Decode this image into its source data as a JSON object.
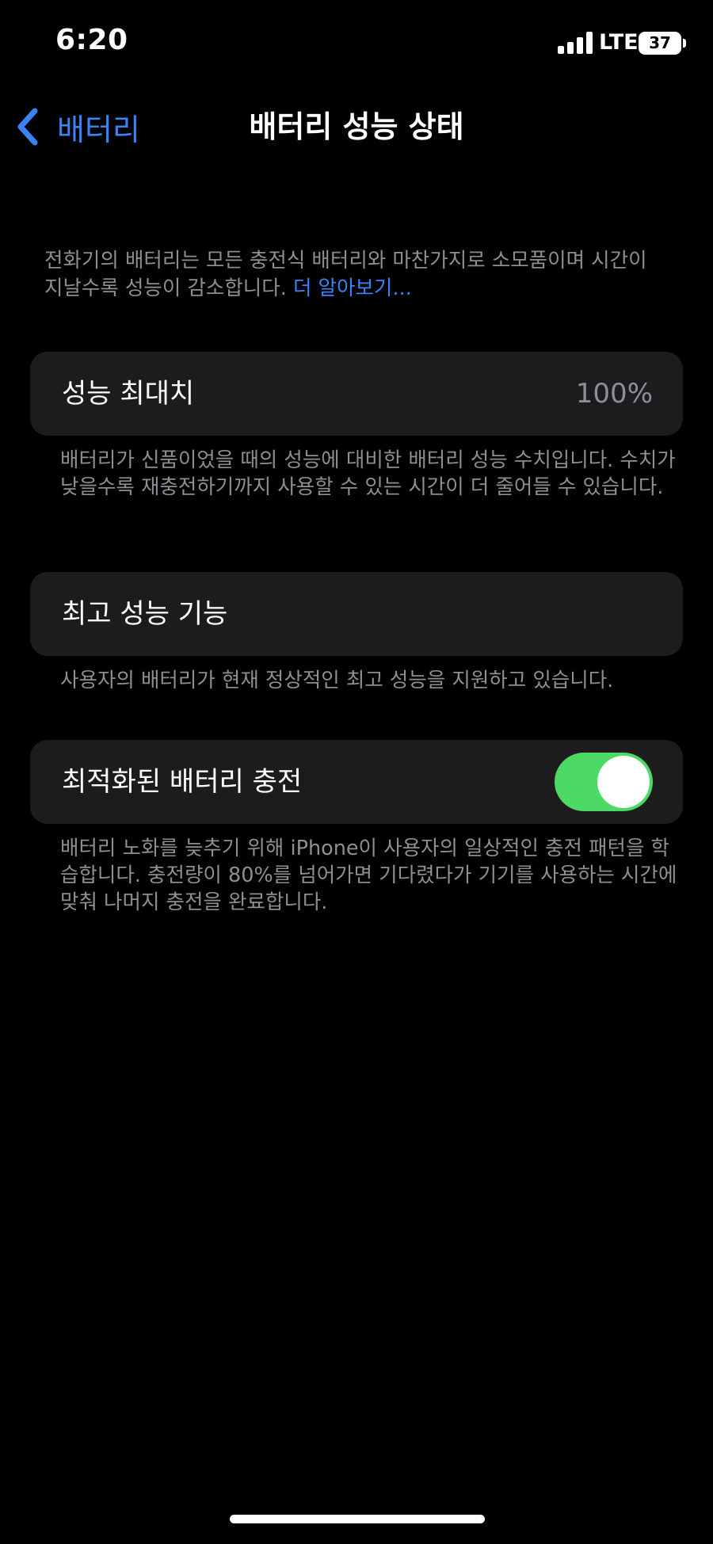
{
  "status_bar": {
    "time": "6:20",
    "network": "LTE",
    "battery_level": "37",
    "icons": [
      "signal-icon",
      "battery-icon"
    ]
  },
  "nav": {
    "back_label": "배터리",
    "title": "배터리 성능 상태",
    "back_icon": "chevron-left-icon"
  },
  "intro": {
    "text": "전화기의 배터리는 모든 충전식 배터리와 마찬가지로 소모품이며 시간이 지날수록 성능이 감소합니다. ",
    "link": "더 알아보기..."
  },
  "max_capacity": {
    "label": "성능 최대치",
    "value": "100%",
    "footer": "배터리가 신품이었을 때의 성능에 대비한 배터리 성능 수치입니다. 수치가 낮을수록 재충전하기까지 사용할 수 있는 시간이 더 줄어들 수 있습니다."
  },
  "peak_performance": {
    "label": "최고 성능 기능",
    "footer": "사용자의 배터리가 현재 정상적인 최고 성능을 지원하고 있습니다."
  },
  "optimized_charging": {
    "label": "최적화된 배터리 충전",
    "enabled": true,
    "footer": "배터리 노화를 늦추기 위해 iPhone이 사용자의 일상적인 충전 패턴을 학습합니다. 충전량이 80%를 넘어가면 기다렸다가 기기를 사용하는 시간에 맞춰 나머지 충전을 완료합니다."
  },
  "colors": {
    "accent": "#3b82f6",
    "toggle_on": "#4cd964",
    "card_bg": "#1c1c1e",
    "secondary_text": "#8e8e93"
  }
}
